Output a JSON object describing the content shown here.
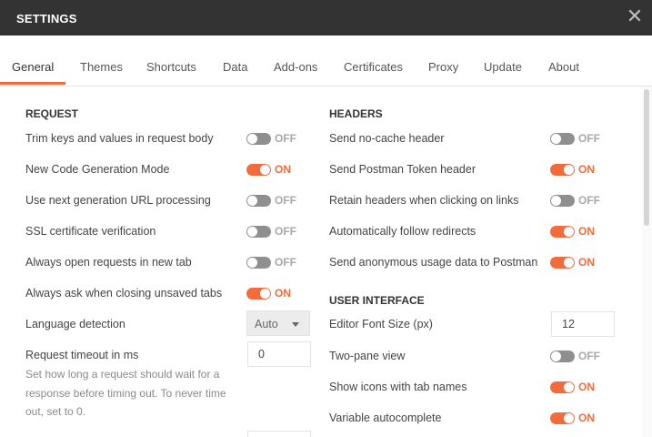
{
  "window": {
    "title": "SETTINGS",
    "close_icon": "close-icon"
  },
  "tabs": [
    "General",
    "Themes",
    "Shortcuts",
    "Data",
    "Add-ons",
    "Certificates",
    "Proxy",
    "Update",
    "About"
  ],
  "active_tab": "General",
  "accent_color": "#f26b3a",
  "request": {
    "heading": "REQUEST",
    "trim_keys": {
      "label": "Trim keys and values in request body",
      "state": "OFF"
    },
    "new_codegen": {
      "label": "New Code Generation Mode",
      "state": "ON"
    },
    "next_gen_url": {
      "label": "Use next generation URL processing",
      "state": "OFF"
    },
    "ssl_verification": {
      "label": "SSL certificate verification",
      "state": "OFF"
    },
    "open_new_tab": {
      "label": "Always open requests in new tab",
      "state": "OFF"
    },
    "ask_closing": {
      "label": "Always ask when closing unsaved tabs",
      "state": "ON"
    },
    "language_detection": {
      "label": "Language detection",
      "value": "Auto"
    },
    "request_timeout": {
      "label": "Request timeout in ms",
      "value": "0",
      "help": "Set how long a request should wait for a response before timing out. To never time out, set to 0."
    }
  },
  "headers": {
    "heading": "HEADERS",
    "no_cache": {
      "label": "Send no-cache header",
      "state": "OFF"
    },
    "postman_token": {
      "label": "Send Postman Token header",
      "state": "ON"
    },
    "retain_headers": {
      "label": "Retain headers when clicking on links",
      "state": "OFF"
    },
    "follow_redirects": {
      "label": "Automatically follow redirects",
      "state": "ON"
    },
    "anonymous_usage": {
      "label": "Send anonymous usage data to Postman",
      "state": "ON"
    }
  },
  "ui": {
    "heading": "USER INTERFACE",
    "font_size": {
      "label": "Editor Font Size (px)",
      "value": "12"
    },
    "two_pane": {
      "label": "Two-pane view",
      "state": "OFF"
    },
    "icons_tab_names": {
      "label": "Show icons with tab names",
      "state": "ON"
    },
    "var_autocomplete": {
      "label": "Variable autocomplete",
      "state": "ON"
    }
  }
}
